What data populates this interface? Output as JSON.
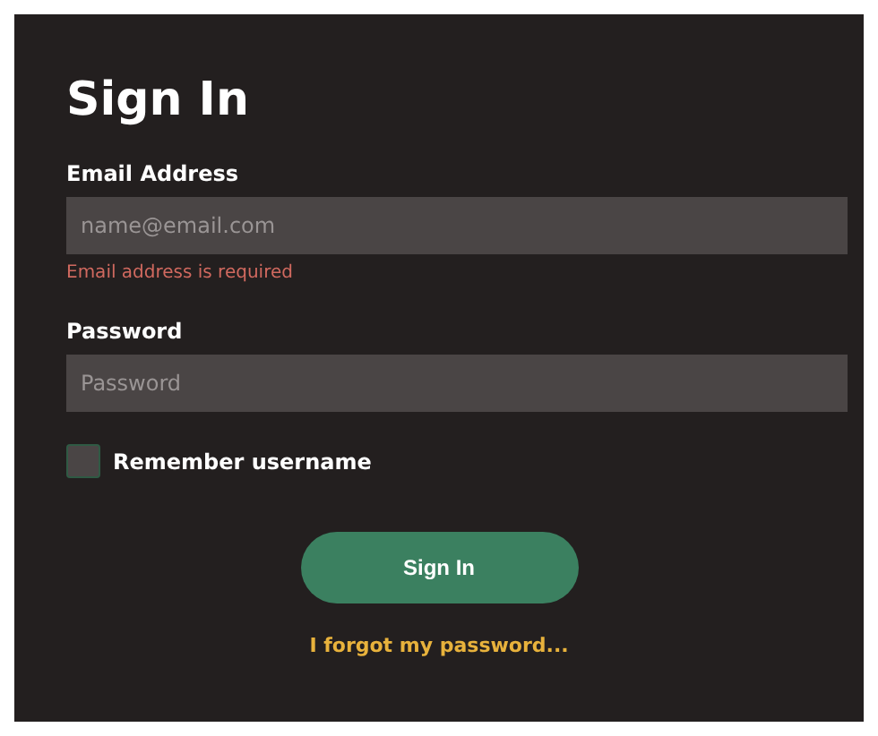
{
  "title": "Sign In",
  "fields": [
    {
      "label": "Email Address",
      "placeholder": "name@email.com",
      "error": "Email address is required"
    },
    {
      "label": "Password",
      "placeholder": "Password"
    }
  ],
  "remember": {
    "label": "Remember username",
    "checked": false
  },
  "submit": "Sign In",
  "forgot_link": "I forgot my password..."
}
